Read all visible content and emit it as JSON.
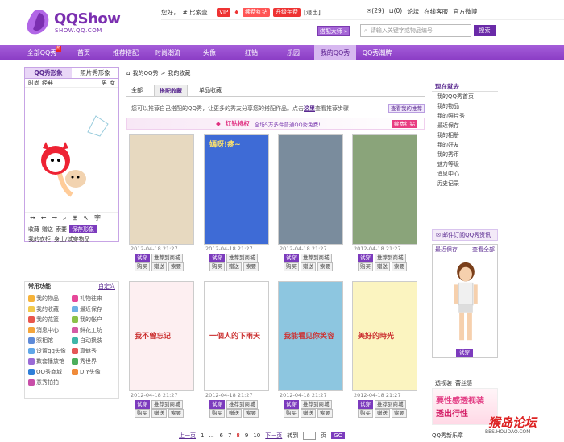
{
  "brand": {
    "name": "QQShow",
    "domain": "SHOW.QQ.COM",
    "accent": "#8a3cc4"
  },
  "toplinks": {
    "hello": "您好，",
    "user": "# 比索壹…",
    "vip": "VIP",
    "red_diamond": "续费红钻",
    "upgrade": "升级年费",
    "logout": "[退出]",
    "msgs": "(29)",
    "cart": "(0)",
    "forum": "论坛",
    "service": "在线客服",
    "weibo": "官方微博"
  },
  "search": {
    "dress_btn": "搭配大师 »",
    "placeholder": "请输入关键字或物品编号",
    "button": "搜索"
  },
  "nav": {
    "items": [
      "全部QQ秀",
      "首页",
      "推荐搭配",
      "时尚潮流",
      "头像",
      "红钻",
      "乐园",
      "我的QQ秀",
      "QQ秀潮牌"
    ],
    "hot": "热"
  },
  "left": {
    "tab1": "QQ秀形象",
    "tab2": "照片秀形象",
    "sub1": "时尚",
    "sub2": "经典",
    "male": "男",
    "female": "女",
    "buttons1": [
      "收藏",
      "赠送",
      "索要"
    ],
    "save": "保存形象",
    "buttons2": [
      "我的衣柜",
      "身上/试穿物品"
    ]
  },
  "functions": {
    "title": "常用功能",
    "custom": "自定义",
    "items": [
      "我的物品",
      "礼物往来",
      "我的收藏",
      "最近保存",
      "我的花篮",
      "我的帐户",
      "消息中心",
      "鲜花工坊",
      "照相馆",
      "自动换装",
      "设置qq头像",
      "真魅秀",
      "数套播放馆",
      "秀世界",
      "QQ秀商城",
      "DIY头像",
      "意秀拍拍"
    ]
  },
  "main": {
    "crumb1": "我的QQ秀",
    "crumb2": "我的收藏",
    "tabs": [
      "全部",
      "搭配收藏",
      "单品收藏"
    ],
    "intro": "您可以推荐自己搭配的QQ秀，让更多的秀友分享您的搭配作品。点击",
    "intro_link": "这里",
    "intro_after": "查看推荐步骤",
    "share": "查看我的推荐",
    "vip_title": "红钻特权",
    "vip_sub": "全场5万多件普通QQ秀免费!",
    "vip_btn": "续费红钻",
    "card_date": "2012-04-18 21:27",
    "btn_try": "试穿",
    "btn_rec": "推荐到商城",
    "btn_buy": "购买",
    "btn_gift": "赠送",
    "btn_ask": "索要",
    "cards": [
      {
        "tint": "#e7d9c0",
        "cap": ""
      },
      {
        "tint": "#3e6bd6",
        "cap": "嫣呀!疼~"
      },
      {
        "tint": "#7a8c9d",
        "cap": ""
      },
      {
        "tint": "#8aa47a",
        "cap": ""
      },
      {
        "tint": "#fdeff1",
        "cap": "我不曾忘记"
      },
      {
        "tint": "#ffffff",
        "cap": "一個人的下雨天"
      },
      {
        "tint": "#8dc6e0",
        "cap": "我能看见你笑容"
      },
      {
        "tint": "#fbf4c0",
        "cap": "美好的時光"
      }
    ]
  },
  "pager": {
    "prev": "上一页",
    "pages": [
      "1",
      "…",
      "6",
      "7",
      "8",
      "9",
      "10"
    ],
    "current": "8",
    "next": "下一页",
    "goto": "转到",
    "page": "页",
    "go": "GO"
  },
  "right": {
    "title": "现在就去",
    "links": [
      "我的QQ秀首页",
      "我的物品",
      "我的照片秀",
      "最近保存",
      "我的相册",
      "我的好友",
      "我的秀币",
      "魅力等级",
      "消息中心",
      "历史记录"
    ],
    "mail": "邮件订阅QQ秀资讯",
    "recent": "最近保存",
    "more": "查看全部",
    "try": "试穿",
    "ad_a": "透视装",
    "ad_b": "蕾丝感",
    "ad1": "要性感",
    "ad2": "透视装",
    "ad3": "透出行性",
    "sig": "QQ秀新乐章"
  },
  "watermark": {
    "a": "猴岛论坛",
    "b": "BBS.HOUDAO.COM"
  }
}
